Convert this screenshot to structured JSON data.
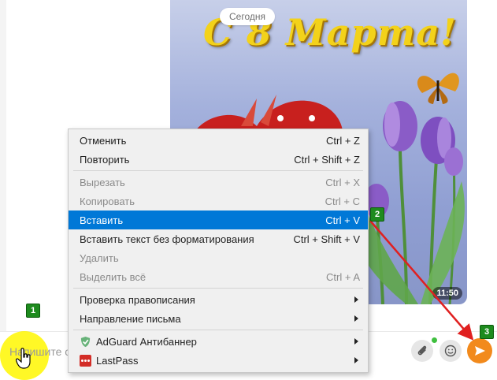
{
  "chat": {
    "date_label": "Сегодня",
    "postcard": {
      "title": "С 8 Марта!",
      "time": "11:50"
    }
  },
  "context_menu": {
    "items": [
      {
        "label": "Отменить",
        "shortcut": "Ctrl + Z",
        "state": "enabled"
      },
      {
        "label": "Повторить",
        "shortcut": "Ctrl + Shift + Z",
        "state": "enabled"
      },
      {
        "label": "Вырезать",
        "shortcut": "Ctrl + X",
        "state": "disabled"
      },
      {
        "label": "Копировать",
        "shortcut": "Ctrl + C",
        "state": "disabled"
      },
      {
        "label": "Вставить",
        "shortcut": "Ctrl + V",
        "state": "highlighted"
      },
      {
        "label": "Вставить текст без форматирования",
        "shortcut": "Ctrl + Shift + V",
        "state": "enabled"
      },
      {
        "label": "Удалить",
        "shortcut": "",
        "state": "disabled"
      },
      {
        "label": "Выделить всё",
        "shortcut": "Ctrl + A",
        "state": "disabled"
      },
      {
        "label": "Проверка правописания",
        "submenu": true
      },
      {
        "label": "Направление письма",
        "submenu": true
      },
      {
        "label": "AdGuard Антибаннер",
        "submenu": true,
        "icon": "adguard-shield-icon"
      },
      {
        "label": "LastPass",
        "submenu": true,
        "icon": "lastpass-icon"
      }
    ],
    "highlight_color": "#0078d7"
  },
  "input": {
    "placeholder": "Напишите с"
  },
  "annotations": {
    "steps": [
      "1",
      "2",
      "3"
    ],
    "badge_color": "#1e8b1e",
    "arrow_color": "#e02020",
    "cursor_highlight": "#fff700"
  },
  "icons": {
    "attach": "paperclip-icon",
    "emoji": "smiley-icon",
    "send": "send-arrow-icon"
  },
  "colors": {
    "send_button": "#f28a1c",
    "online_dot": "#3fbf3f"
  }
}
